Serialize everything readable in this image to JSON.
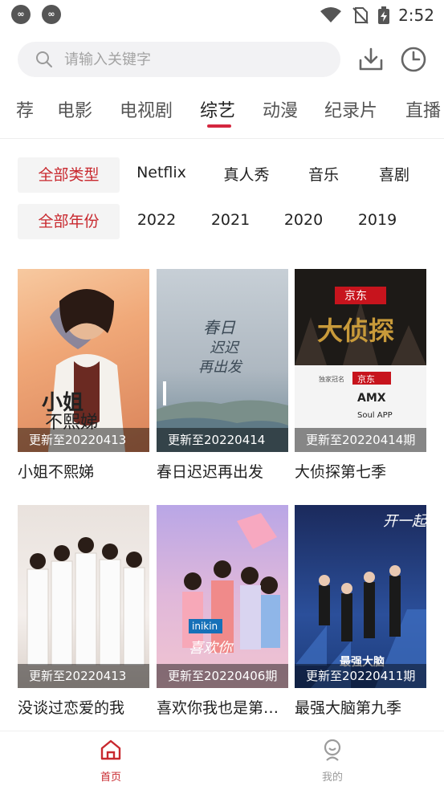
{
  "status": {
    "time": "2:52"
  },
  "search": {
    "placeholder": "请输入关键字"
  },
  "tabs": [
    "荐",
    "电影",
    "电视剧",
    "综艺",
    "动漫",
    "纪录片",
    "直播"
  ],
  "filters": {
    "types": [
      "全部类型",
      "Netflix",
      "真人秀",
      "音乐",
      "喜剧"
    ],
    "years": [
      "全部年份",
      "2022",
      "2021",
      "2020",
      "2019"
    ]
  },
  "items": [
    {
      "title": "小姐不熙娣",
      "update": "更新至20220413"
    },
    {
      "title": "春日迟迟再出发",
      "update": "更新至20220414"
    },
    {
      "title": "大侦探第七季",
      "update": "更新至20220414期"
    },
    {
      "title": "没谈过恋爱的我",
      "update": "更新至20220413"
    },
    {
      "title": "喜欢你我也是第…",
      "update": "更新至20220406期"
    },
    {
      "title": "最强大脑第九季",
      "update": "更新至20220411期"
    }
  ],
  "bottom_nav": [
    {
      "label": "首页",
      "active": true,
      "color": "#c8282e"
    },
    {
      "label": "我的",
      "active": false,
      "color": "#9b9b9b"
    }
  ],
  "colors": {
    "accent": "#d4273f",
    "selected_text": "#c8282e"
  }
}
